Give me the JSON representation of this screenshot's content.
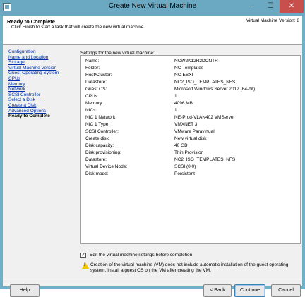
{
  "window": {
    "title": "Create New Virtual Machine",
    "minimize_glyph": "–",
    "maximize_glyph": "☐",
    "close_glyph": "✕",
    "app_icon": "vm-icon"
  },
  "header": {
    "title": "Ready to Complete",
    "subtitle": "Click Finish to start a task that will create the new virtual machine",
    "version": "Virtual Machine Version: 8"
  },
  "nav": {
    "items": [
      {
        "label": "Configuration",
        "current": false
      },
      {
        "label": "Name and Location",
        "current": false
      },
      {
        "label": "Storage",
        "current": false
      },
      {
        "label": "Virtual Machine Version",
        "current": false
      },
      {
        "label": "Guest Operating System",
        "current": false
      },
      {
        "label": "CPUs",
        "current": false
      },
      {
        "label": "Memory",
        "current": false
      },
      {
        "label": "Network",
        "current": false
      },
      {
        "label": "SCSI Controller",
        "current": false
      },
      {
        "label": "Select a Disk",
        "current": false
      },
      {
        "label": "Create a Disk",
        "current": false
      },
      {
        "label": "Advanced Options",
        "current": false
      },
      {
        "label": "Ready to Complete",
        "current": true
      }
    ]
  },
  "settings": {
    "label": "Settings for the new virtual machine:",
    "rows": [
      {
        "key": "Name:",
        "value": "NCW2K12R2DCNTR"
      },
      {
        "key": "Folder:",
        "value": "NC-Templates"
      },
      {
        "key": "Host/Cluster:",
        "value": "NC-ESXI"
      },
      {
        "key": "Datastore:",
        "value": "NC2_ISO_TEMPLATES_NFS"
      },
      {
        "key": "Guest OS:",
        "value": "Microsoft Windows Server 2012 (64-bit)"
      },
      {
        "key": "CPUs:",
        "value": "1"
      },
      {
        "key": "Memory:",
        "value": "4096 MB"
      },
      {
        "key": "NICs:",
        "value": "1"
      },
      {
        "key": "NIC 1 Network:",
        "value": "NE-Prod-VLAN402 VMServer"
      },
      {
        "key": "NIC 1 Type:",
        "value": "VMXNET 3"
      },
      {
        "key": "SCSI Controller:",
        "value": "VMware Paravirtual"
      },
      {
        "key": "Create disk:",
        "value": "New virtual disk"
      },
      {
        "key": "Disk capacity:",
        "value": "40 GB"
      },
      {
        "key": "Disk provisioning:",
        "value": "Thin Provision"
      },
      {
        "key": "Datastore:",
        "value": "NC2_ISO_TEMPLATES_NFS"
      },
      {
        "key": "Virtual Device Node:",
        "value": "SCSI (0:0)"
      },
      {
        "key": "Disk mode:",
        "value": "Persistent"
      }
    ]
  },
  "edit_checkbox": {
    "checked": true,
    "glyph": "✓",
    "label": "Edit the virtual machine settings before completion"
  },
  "warning": {
    "icon": "warning-icon",
    "glyph": "!",
    "text": "Creation of the virtual machine (VM) does not include automatic installation of the guest operating system. Install a guest OS on the VM after creating the VM."
  },
  "buttons": {
    "help": "Help",
    "back": "< Back",
    "continue": "Continue",
    "cancel": "Cancel"
  }
}
